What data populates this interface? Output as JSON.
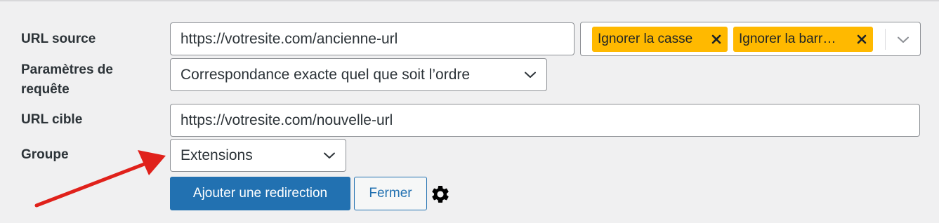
{
  "form": {
    "source_url": {
      "label": "URL source",
      "value": "https://votresite.com/ancienne-url"
    },
    "source_options": {
      "tags": [
        {
          "label": "Ignorer la casse"
        },
        {
          "label": "Ignorer la barr…"
        }
      ],
      "tag_color": "#ffb900"
    },
    "query_params": {
      "label_line1": "Paramètres de",
      "label_line2": "requête",
      "selected": "Correspondance exacte quel que soit l’ordre"
    },
    "target_url": {
      "label": "URL cible",
      "value": "https://votresite.com/nouvelle-url"
    },
    "group": {
      "label": "Groupe",
      "selected": "Extensions"
    },
    "buttons": {
      "add_label": "Ajouter une redirection",
      "close_label": "Fermer"
    },
    "icons": {
      "settings": "gear-icon",
      "annotation": "red-arrow-icon"
    }
  },
  "colors": {
    "background": "#f0f0f1",
    "primary": "#2271b1",
    "arrow": "#e0211b"
  }
}
